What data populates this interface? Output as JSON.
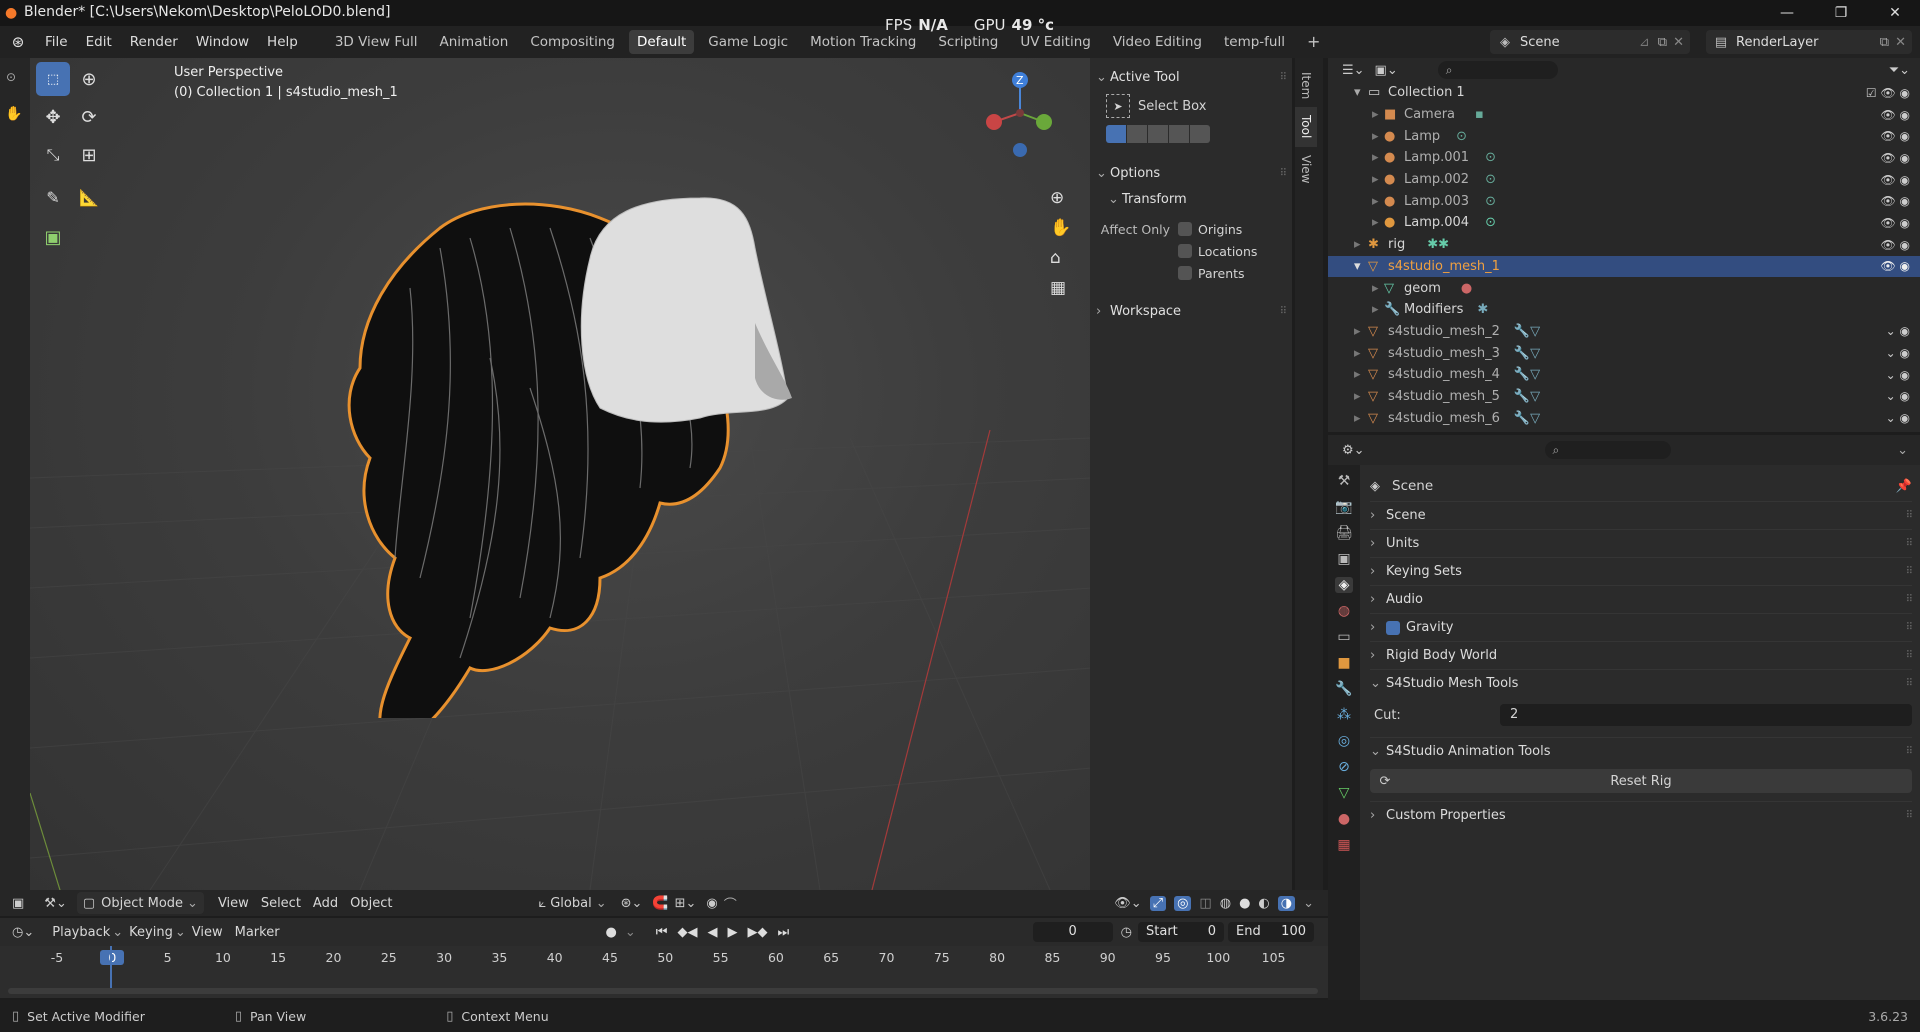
{
  "titlebar": {
    "title": "Blender* [C:\\Users\\Nekom\\Desktop\\PeloLOD0.blend]"
  },
  "menu": {
    "file": "File",
    "edit": "Edit",
    "render": "Render",
    "window": "Window",
    "help": "Help"
  },
  "workspaces": [
    "3D View Full",
    "Animation",
    "Compositing",
    "Default",
    "Game Logic",
    "Motion Tracking",
    "Scripting",
    "UV Editing",
    "Video Editing",
    "temp-full"
  ],
  "active_workspace": "Default",
  "hud": {
    "fps_label": "FPS",
    "fps_value": "N/A",
    "gpu_label": "GPU",
    "gpu_value": "49 °c"
  },
  "scene_selector": {
    "scene": "Scene",
    "render_layer": "RenderLayer"
  },
  "viewport": {
    "perspective": "User Perspective",
    "context": "(0) Collection 1 | s4studio_mesh_1"
  },
  "gizmo": {
    "z_label": "Z"
  },
  "npanel": {
    "tabs": [
      "Item",
      "Tool",
      "View"
    ],
    "active_tool_header": "Active Tool",
    "active_tool_name": "Select Box",
    "options_header": "Options",
    "transform_header": "Transform",
    "affect_only_label": "Affect Only",
    "origins": "Origins",
    "locations": "Locations",
    "parents": "Parents",
    "workspace_header": "Workspace"
  },
  "outliner": {
    "rows": [
      {
        "name": "Collection 1"
      },
      {
        "name": "Camera"
      },
      {
        "name": "Lamp"
      },
      {
        "name": "Lamp.001"
      },
      {
        "name": "Lamp.002"
      },
      {
        "name": "Lamp.003"
      },
      {
        "name": "Lamp.004"
      },
      {
        "name": "rig"
      },
      {
        "name": "s4studio_mesh_1"
      },
      {
        "name": "geom"
      },
      {
        "name": "Modifiers"
      },
      {
        "name": "s4studio_mesh_2"
      },
      {
        "name": "s4studio_mesh_3"
      },
      {
        "name": "s4studio_mesh_4"
      },
      {
        "name": "s4studio_mesh_5"
      },
      {
        "name": "s4studio_mesh_6"
      }
    ]
  },
  "properties": {
    "context_title": "Scene",
    "sections": [
      "Scene",
      "Units",
      "Keying Sets",
      "Audio",
      "Gravity",
      "Rigid Body World"
    ],
    "mesh_tools_header": "S4Studio Mesh Tools",
    "cut_label": "Cut:",
    "cut_value": "2",
    "anim_tools_header": "S4Studio Animation Tools",
    "reset_rig": "Reset Rig",
    "custom_props": "Custom Properties"
  },
  "viewport_header": {
    "mode": "Object Mode",
    "view": "View",
    "select": "Select",
    "add": "Add",
    "object": "Object",
    "orientation": "Global"
  },
  "timeline": {
    "playback": "Playback",
    "keying": "Keying",
    "view": "View",
    "marker": "Marker",
    "current_frame": "0",
    "start_label": "Start",
    "start_value": "0",
    "end_label": "End",
    "end_value": "100",
    "ruler_labels": [
      "-5",
      "0",
      "5",
      "10",
      "15",
      "20",
      "25",
      "30",
      "35",
      "40",
      "45",
      "50",
      "55",
      "60",
      "65",
      "70",
      "75",
      "80",
      "85",
      "90",
      "95",
      "100",
      "105"
    ]
  },
  "statusbar": {
    "left": "Set Active Modifier",
    "mid": "Pan View",
    "right": "Context Menu",
    "version": "3.6.23"
  }
}
